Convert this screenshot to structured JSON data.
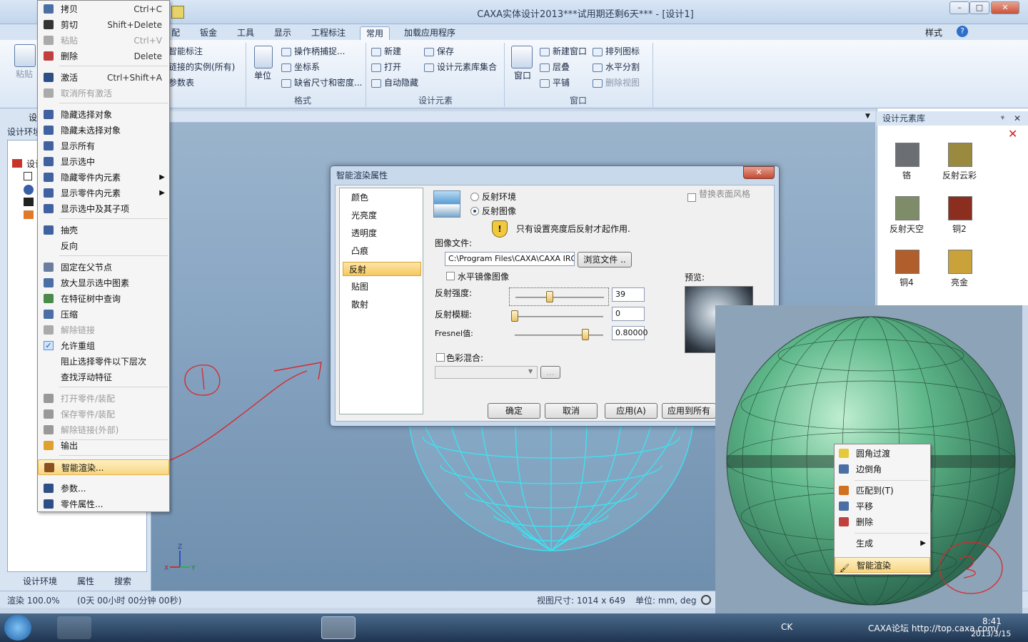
{
  "window": {
    "title": "CAXA实体设计2013***试用期还剩6天*** - [设计1]",
    "style_label": "样式",
    "min_glyph": "–",
    "max_glyph": "□",
    "close_glyph": "✕"
  },
  "ribbon": {
    "tabs": [
      "配",
      "钣金",
      "工具",
      "显示",
      "工程标注",
      "常用",
      "加载应用程序"
    ],
    "active_tab": "常用",
    "paste_label": "粘贴",
    "groups": {
      "annot": {
        "items": [
          "智能标注",
          "链接的实例(所有)",
          "参数表"
        ]
      },
      "format": {
        "label": "格式",
        "unit_label": "单位",
        "items": [
          "操作柄捕捉...",
          "坐标系",
          "缺省尺寸和密度..."
        ]
      },
      "design_elements": {
        "label": "设计元素",
        "items": [
          "新建",
          "打开",
          "自动隐藏",
          "保存",
          "设计元素库集合"
        ]
      },
      "window": {
        "label": "窗口",
        "big_label": "窗口",
        "items": [
          "新建窗口",
          "层叠",
          "平铺",
          "排列图标",
          "水平分割",
          "删除视图"
        ]
      }
    }
  },
  "left_panel": {
    "tab_top": "设",
    "env_label": "设计环境",
    "tree_root": "设计",
    "bottom_tabs": [
      "设计环境",
      "属性",
      "搜索"
    ]
  },
  "library": {
    "title": "设计元素库",
    "pin": "ᵠ",
    "close": "✕",
    "items": [
      {
        "label": "铬",
        "color": "#6b6f74"
      },
      {
        "label": "反射云彩",
        "color": "#9a8a40"
      },
      {
        "label": "反射天空",
        "color": "#7f8c6a"
      },
      {
        "label": "铜2",
        "color": "#8c2e1f"
      },
      {
        "label": "铜4",
        "color": "#b05e2c"
      },
      {
        "label": "亮金",
        "color": "#c9a23a"
      }
    ]
  },
  "context_menu": {
    "items": [
      {
        "label": "拷贝",
        "shortcut": "Ctrl+C",
        "disabled": false
      },
      {
        "label": "剪切",
        "shortcut": "Shift+Delete",
        "disabled": false
      },
      {
        "label": "粘贴",
        "shortcut": "Ctrl+V",
        "disabled": true
      },
      {
        "label": "删除",
        "shortcut": "Delete",
        "disabled": false
      },
      {
        "label": "激活",
        "shortcut": "Ctrl+Shift+A",
        "disabled": false
      },
      {
        "label": "取消所有激活",
        "shortcut": "",
        "disabled": true
      },
      {
        "label": "隐藏选择对象",
        "shortcut": "",
        "disabled": false
      },
      {
        "label": "隐藏未选择对象",
        "shortcut": "",
        "disabled": false
      },
      {
        "label": "显示所有",
        "shortcut": "",
        "disabled": false
      },
      {
        "label": "显示选中",
        "shortcut": "",
        "disabled": false
      },
      {
        "label": "隐藏零件内元素",
        "shortcut": "",
        "disabled": false,
        "submenu": true
      },
      {
        "label": "显示零件内元素",
        "shortcut": "",
        "disabled": false,
        "submenu": true
      },
      {
        "label": "显示选中及其子项",
        "shortcut": "",
        "disabled": false
      },
      {
        "label": "抽壳",
        "shortcut": "",
        "disabled": false
      },
      {
        "label": "反向",
        "shortcut": "",
        "disabled": false
      },
      {
        "label": "固定在父节点",
        "shortcut": "",
        "disabled": false
      },
      {
        "label": "放大显示选中图素",
        "shortcut": "",
        "disabled": false
      },
      {
        "label": "在特征树中查询",
        "shortcut": "",
        "disabled": false
      },
      {
        "label": "压缩",
        "shortcut": "",
        "disabled": false
      },
      {
        "label": "解除链接",
        "shortcut": "",
        "disabled": true
      },
      {
        "label": "允许重组",
        "shortcut": "",
        "disabled": false,
        "checked": true
      },
      {
        "label": "阻止选择零件以下层次",
        "shortcut": "",
        "disabled": false
      },
      {
        "label": "查找浮动特征",
        "shortcut": "",
        "disabled": false
      },
      {
        "label": "打开零件/装配",
        "shortcut": "",
        "disabled": true
      },
      {
        "label": "保存零件/装配",
        "shortcut": "",
        "disabled": true
      },
      {
        "label": "解除链接(外部)",
        "shortcut": "",
        "disabled": true
      },
      {
        "label": "输出",
        "shortcut": "",
        "disabled": false
      },
      {
        "label": "智能渲染...",
        "shortcut": "",
        "disabled": false,
        "highlight": true
      },
      {
        "label": "参数...",
        "shortcut": "",
        "disabled": false
      },
      {
        "label": "零件属性...",
        "shortcut": "",
        "disabled": false
      }
    ]
  },
  "dialog": {
    "title": "智能渲染属性",
    "close": "✕",
    "categories": [
      "颜色",
      "光亮度",
      "透明度",
      "凸痕",
      "反射",
      "贴图",
      "散射"
    ],
    "selected_category": "反射",
    "radio_env": "反射环境",
    "radio_image": "反射图像",
    "replace_style": "替换表面风格",
    "hint": "只有设置亮度后反射才起作用.",
    "image_file_label": "图像文件:",
    "image_file_value": "C:\\Program Files\\CAXA\\CAXA IRO",
    "browse_label": "浏览文件 ..",
    "mirror_label": "水平镜像图像",
    "preview_label": "预览:",
    "reflect_strength_label": "反射强度:",
    "reflect_strength_value": "39",
    "reflect_strength_fraction": 0.39,
    "reflect_blur_label": "反射模糊:",
    "reflect_blur_value": "0",
    "reflect_blur_fraction": 0.0,
    "fresnel_label": "Fresnel值:",
    "fresnel_value": "0.80000",
    "fresnel_fraction": 0.8,
    "color_mix_label": "色彩混合:",
    "ellipsis": "...",
    "ok": "确定",
    "cancel": "取消",
    "apply": "应用(A)",
    "apply_all": "应用到所有"
  },
  "overlay_menu": {
    "items": [
      "圆角过渡",
      "边倒角",
      "匹配到(T)",
      "平移",
      "删除",
      "生成",
      "智能渲染"
    ],
    "highlight": "智能渲染"
  },
  "annotations": {
    "one": "①",
    "two": "②"
  },
  "viewport": {
    "axis_z": "Z",
    "axis_x": "X",
    "axis_y": "Y"
  },
  "status": {
    "render": "渲染 100.0%",
    "time": "(0天 00小时 00分钟 00秒)",
    "view_size": "视图尺寸: 1014 x 649",
    "unit": "单位: mm, deg"
  },
  "taskbar": {
    "tray_text": "CK",
    "forum_text": "CAXA论坛 http://top.caxa.com/",
    "time": "8:41",
    "date": "2013/3/15"
  },
  "colors": {
    "sphere_cyan": "#39e6f2",
    "sphere_green": "#5fb88a",
    "annotation_red": "#d8282c",
    "accent_highlight": "#f5c85f"
  }
}
